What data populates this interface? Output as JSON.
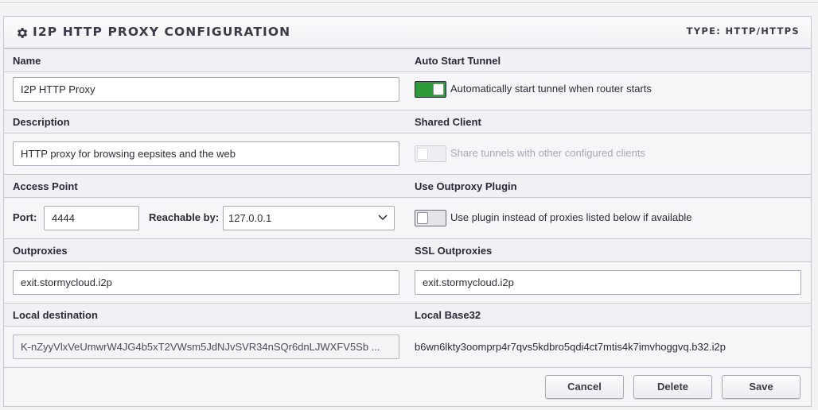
{
  "header": {
    "title": "I2P HTTP PROXY CONFIGURATION",
    "type_label": "TYPE: HTTP/HTTPS"
  },
  "sections": {
    "name": {
      "label": "Name",
      "value": "I2P HTTP Proxy"
    },
    "auto_start": {
      "label": "Auto Start Tunnel",
      "toggle_text": "Automatically start tunnel when router starts",
      "enabled": true
    },
    "description": {
      "label": "Description",
      "value": "HTTP proxy for browsing eepsites and the web"
    },
    "shared_client": {
      "label": "Shared Client",
      "toggle_text": "Share tunnels with other configured clients",
      "enabled": false,
      "disabled": true
    },
    "access_point": {
      "label": "Access Point",
      "port_label": "Port:",
      "port_value": "4444",
      "reachable_label": "Reachable by:",
      "reachable_value": "127.0.0.1"
    },
    "outproxy_plugin": {
      "label": "Use Outproxy Plugin",
      "toggle_text": "Use plugin instead of proxies listed below if available",
      "enabled": false
    },
    "outproxies": {
      "label": "Outproxies",
      "value": "exit.stormycloud.i2p"
    },
    "ssl_outproxies": {
      "label": "SSL Outproxies",
      "value": "exit.stormycloud.i2p"
    },
    "local_destination": {
      "label": "Local destination",
      "value": "K-nZyyVlxVeUmwrW4JG4b5xT2VWsm5JdNJvSVR34nSQr6dnLJWXFV5Sb ..."
    },
    "local_base32": {
      "label": "Local Base32",
      "value": "b6wn6lkty3oomprp4r7qvs5kdbro5qdi4ct7mtis4k7imvhoggvq.b32.i2p"
    }
  },
  "buttons": {
    "cancel": "Cancel",
    "delete": "Delete",
    "save": "Save"
  },
  "colors": {
    "toggle_on": "#2f9a3a",
    "panel_bg": "#f6f6f9",
    "border": "#c7c7d1"
  },
  "icons": {
    "header": "gear-icon",
    "select": "chevron-down-icon"
  }
}
